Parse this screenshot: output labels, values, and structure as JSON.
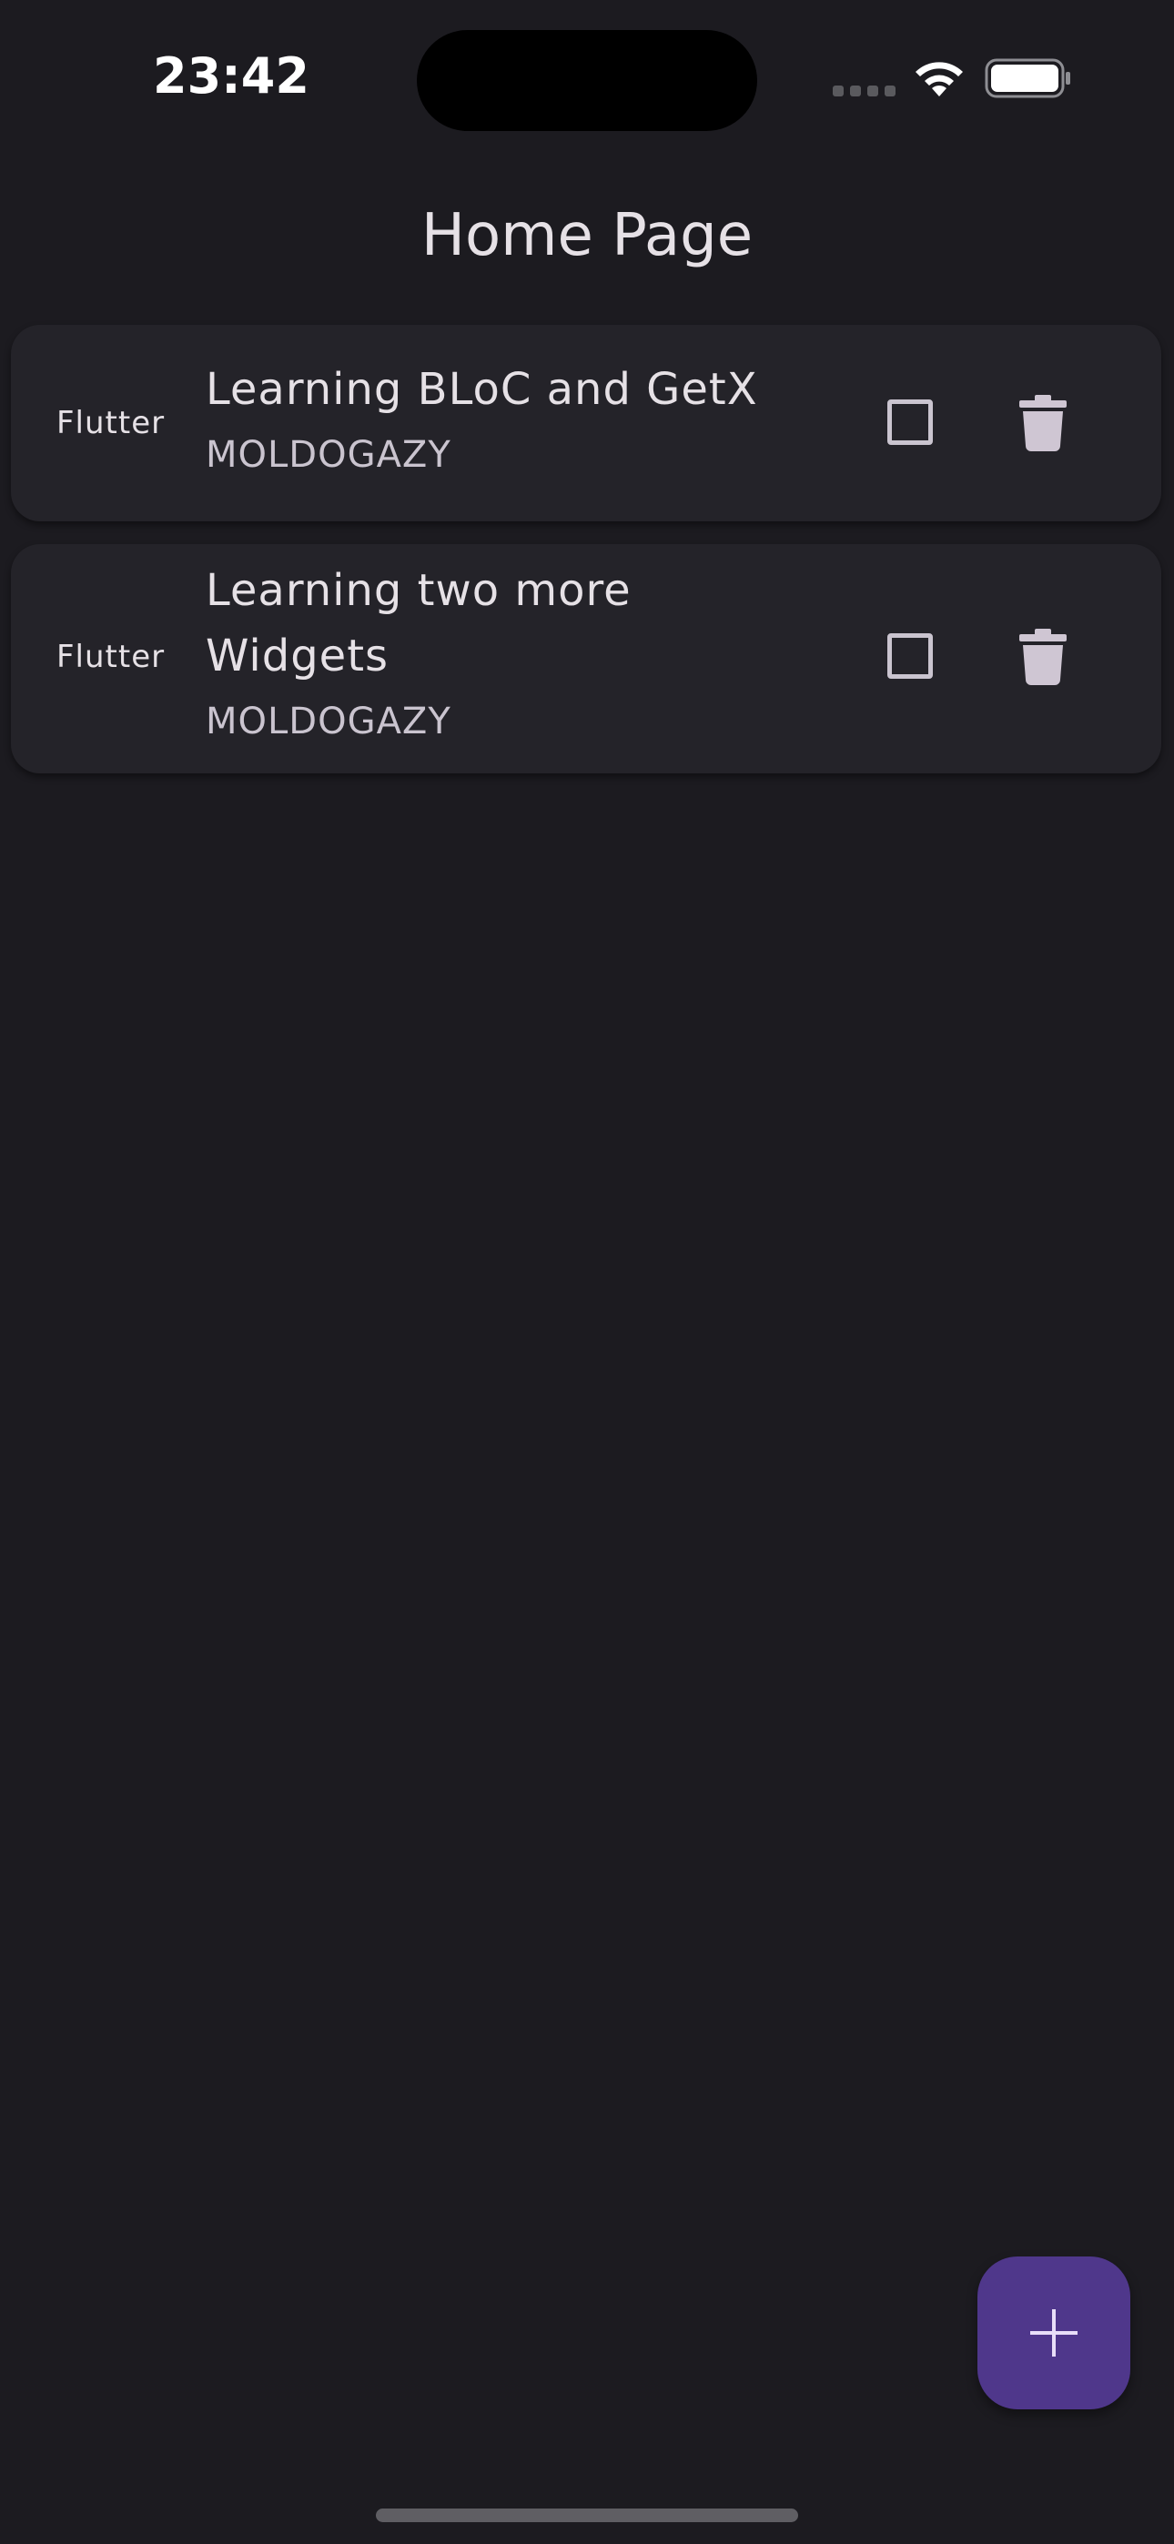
{
  "status_bar": {
    "time": "23:42"
  },
  "app_bar": {
    "title": "Home Page"
  },
  "tasks": [
    {
      "category": "Flutter",
      "title": "Learning BLoC and GetX",
      "author": "MOLDOGAZY",
      "checked": false,
      "checkbox_icon": "checkbox-outline-icon",
      "delete_icon": "trash-icon"
    },
    {
      "category": "Flutter",
      "title": "Learning two more Widgets",
      "author": "MOLDOGAZY",
      "checked": false,
      "checkbox_icon": "checkbox-outline-icon",
      "delete_icon": "trash-icon"
    }
  ],
  "fab": {
    "icon": "plus-icon"
  },
  "colors": {
    "background": "#1c1b20",
    "card": "#242329",
    "fab": "#4f378b",
    "text": "#e6e1e6",
    "icon": "#cac4cf"
  }
}
